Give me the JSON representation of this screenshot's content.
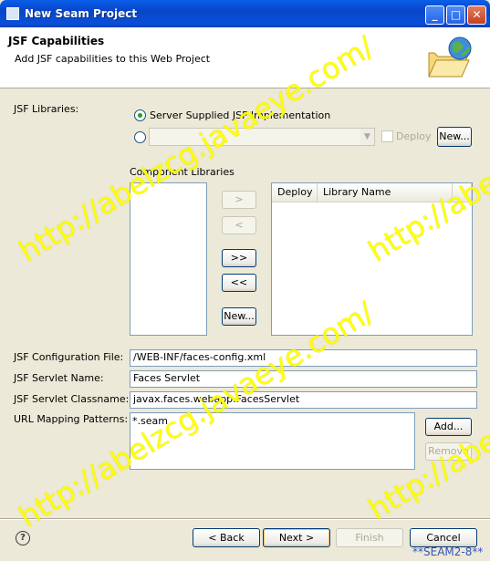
{
  "window": {
    "title": "New Seam Project",
    "controls": {
      "minimize": "_",
      "maximize": "□",
      "close": "✕"
    }
  },
  "header": {
    "title": "JSF Capabilities",
    "description": "Add JSF capabilities to this Web Project",
    "icon": "folder-globe-icon"
  },
  "jsf_libraries": {
    "label": "JSF Libraries:",
    "option_server": "Server Supplied JSF Implementation",
    "option_other_value": "",
    "deploy_label": "Deploy",
    "new_button": "New..."
  },
  "component_libraries": {
    "label": "Component Libraries",
    "move_right": ">",
    "move_left": "<",
    "move_all_right": ">>",
    "move_all_left": "<<",
    "new_button": "New...",
    "columns": [
      "Deploy",
      "Library Name"
    ]
  },
  "config": {
    "config_file_label": "JSF Configuration File:",
    "config_file_value": "/WEB-INF/faces-config.xml",
    "servlet_name_label": "JSF Servlet Name:",
    "servlet_name_value": "Faces Servlet",
    "servlet_class_label": "JSF Servlet Classname:",
    "servlet_class_value": "javax.faces.webapp.FacesServlet",
    "url_mapping_label": "URL Mapping Patterns:",
    "url_mapping_items": [
      "*.seam"
    ],
    "add_button": "Add...",
    "remove_button": "Remove"
  },
  "footer": {
    "help": "?",
    "back": "< Back",
    "next": "Next >",
    "finish": "Finish",
    "cancel": "Cancel",
    "tag": "**SEAM2-8**"
  },
  "watermark": "http://abelzcg.javaeye.com/",
  "colors": {
    "title_bar": "#0a5ee9",
    "dialog_bg": "#ece9d8",
    "watermark": "#ffff00"
  }
}
